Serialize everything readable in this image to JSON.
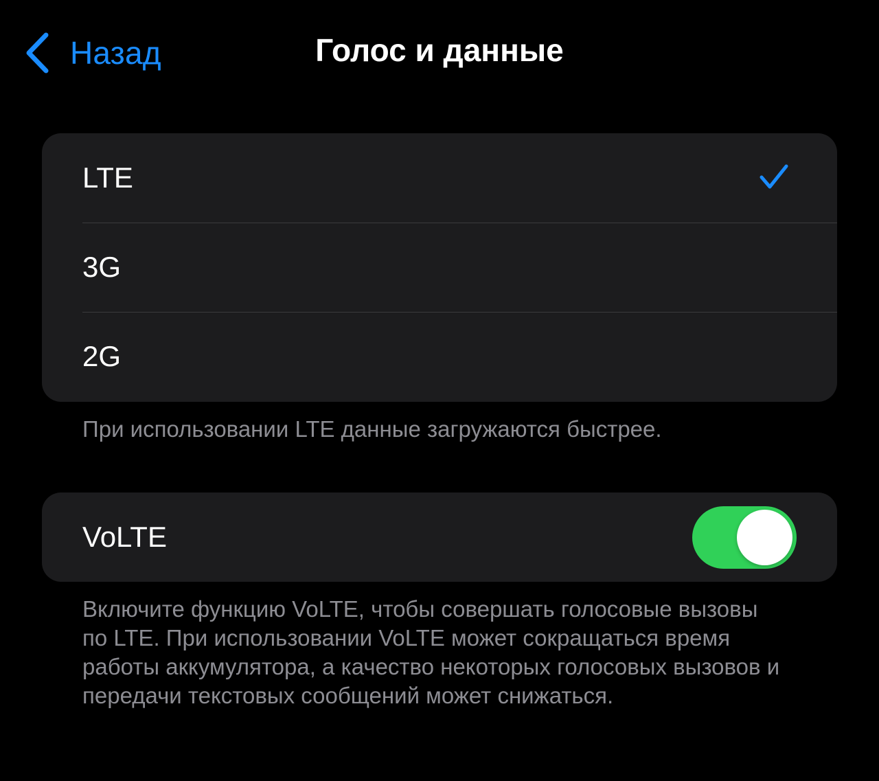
{
  "nav": {
    "back_label": "Назад",
    "title": "Голос и данные"
  },
  "network": {
    "options": [
      {
        "label": "LTE",
        "selected": true
      },
      {
        "label": "3G",
        "selected": false
      },
      {
        "label": "2G",
        "selected": false
      }
    ],
    "footer": "При использовании LTE данные загружаются быстрее."
  },
  "volte": {
    "label": "VoLTE",
    "enabled": true,
    "footer": "Включите функцию VoLTE, чтобы совершать голосовые вызовы по LTE. При использовании VoLTE может сокращаться время работы аккумулятора, а качество некоторых голосовых вызовов и передачи текстовых сообщений может снижаться."
  },
  "colors": {
    "accent": "#1a8cff",
    "toggle_on": "#30d158",
    "background": "#000000",
    "group_background": "#1c1c1e",
    "footer_text": "#8d8d93"
  },
  "icons": {
    "back": "chevron-left-icon",
    "selected": "checkmark-icon"
  }
}
